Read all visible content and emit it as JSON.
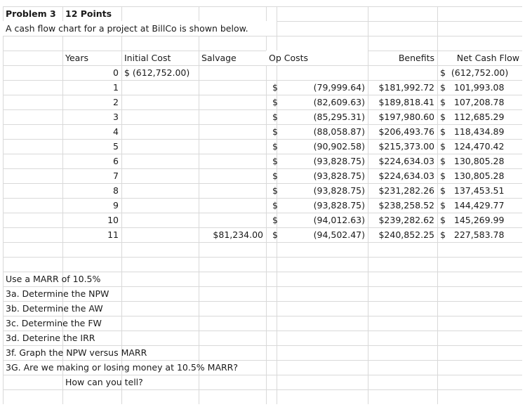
{
  "header": {
    "problem": "Problem 3",
    "points": "12 Points",
    "description": "A cash flow chart for a project at BillCo is shown below."
  },
  "table": {
    "columns": [
      "Years",
      "Initial Cost",
      "Salvage",
      "Op Costs",
      "Benefits",
      "Net Cash Flow"
    ],
    "rows": [
      {
        "year": "0",
        "initial": "$ (612,752.00)",
        "salvage": "",
        "op_dollar": "",
        "op": "",
        "benefits": "",
        "net": "$  (612,752.00)"
      },
      {
        "year": "1",
        "initial": "",
        "salvage": "",
        "op_dollar": "$",
        "op": "(79,999.64)",
        "benefits": "$181,992.72",
        "net": "$   101,993.08"
      },
      {
        "year": "2",
        "initial": "",
        "salvage": "",
        "op_dollar": "$",
        "op": "(82,609.63)",
        "benefits": "$189,818.41",
        "net": "$   107,208.78"
      },
      {
        "year": "3",
        "initial": "",
        "salvage": "",
        "op_dollar": "$",
        "op": "(85,295.31)",
        "benefits": "$197,980.60",
        "net": "$   112,685.29"
      },
      {
        "year": "4",
        "initial": "",
        "salvage": "",
        "op_dollar": "$",
        "op": "(88,058.87)",
        "benefits": "$206,493.76",
        "net": "$   118,434.89"
      },
      {
        "year": "5",
        "initial": "",
        "salvage": "",
        "op_dollar": "$",
        "op": "(90,902.58)",
        "benefits": "$215,373.00",
        "net": "$   124,470.42"
      },
      {
        "year": "6",
        "initial": "",
        "salvage": "",
        "op_dollar": "$",
        "op": "(93,828.75)",
        "benefits": "$224,634.03",
        "net": "$   130,805.28"
      },
      {
        "year": "7",
        "initial": "",
        "salvage": "",
        "op_dollar": "$",
        "op": "(93,828.75)",
        "benefits": "$224,634.03",
        "net": "$   130,805.28"
      },
      {
        "year": "8",
        "initial": "",
        "salvage": "",
        "op_dollar": "$",
        "op": "(93,828.75)",
        "benefits": "$231,282.26",
        "net": "$   137,453.51"
      },
      {
        "year": "9",
        "initial": "",
        "salvage": "",
        "op_dollar": "$",
        "op": "(93,828.75)",
        "benefits": "$238,258.52",
        "net": "$   144,429.77"
      },
      {
        "year": "10",
        "initial": "",
        "salvage": "",
        "op_dollar": "$",
        "op": "(94,012.63)",
        "benefits": "$239,282.62",
        "net": "$   145,269.99"
      },
      {
        "year": "11",
        "initial": "",
        "salvage": "$81,234.00",
        "op_dollar": "$",
        "op": "(94,502.47)",
        "benefits": "$240,852.25",
        "net": "$   227,583.78"
      }
    ]
  },
  "questions": {
    "marr": "Use a MARR of 10.5%",
    "q3a": "3a. Determine the NPW",
    "q3b": "3b. Determine the AW",
    "q3c": "3c. Determine the FW",
    "q3d": "3d. Deterine the IRR",
    "q3f": "3f. Graph the NPW versus MARR",
    "q3g": "3G. Are we making or losing money at 10.5% MARR?",
    "followup": "How can you tell?"
  }
}
